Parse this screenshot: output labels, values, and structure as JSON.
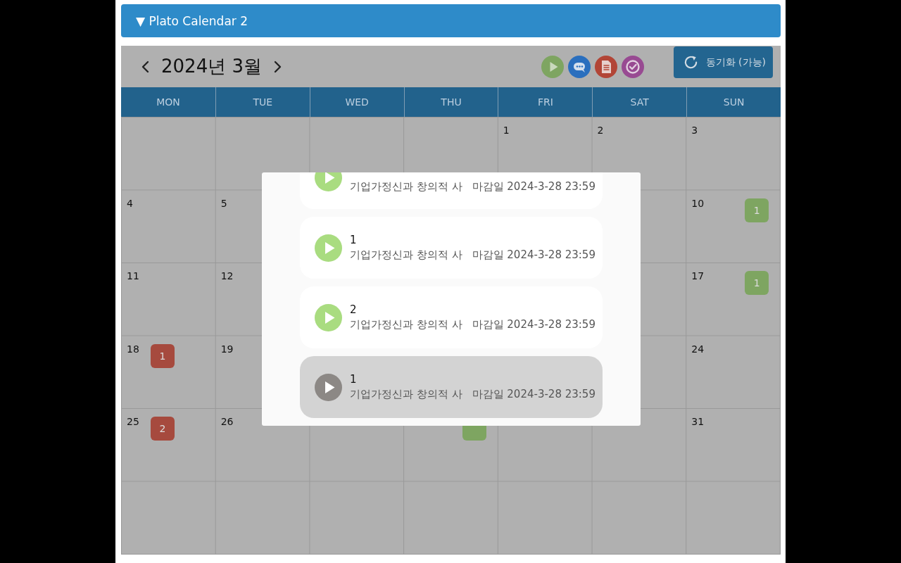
{
  "panel": {
    "title": "▼ Plato Calendar 2"
  },
  "calendar": {
    "month_label": "2024년 3월",
    "sync_button": "동기화 (가능)",
    "weekdays": [
      "MON",
      "TUE",
      "WED",
      "THU",
      "FRI",
      "SAT",
      "SUN"
    ],
    "weeks": [
      {
        "fri": {
          "day": "1"
        },
        "sat": {
          "day": "2"
        },
        "sun": {
          "day": "3"
        }
      },
      {
        "mon": {
          "day": "4"
        },
        "tue": {
          "day": "5"
        },
        "sun": {
          "day": "10",
          "badges": [
            {
              "kind": "video",
              "text": "1",
              "color": "#7ea561"
            }
          ]
        }
      },
      {
        "mon": {
          "day": "11"
        },
        "tue": {
          "day": "12"
        },
        "sun": {
          "day": "17",
          "badges": [
            {
              "kind": "video",
              "text": "1",
              "color": "#7ea561"
            }
          ]
        }
      },
      {
        "mon": {
          "day": "18",
          "badges": [
            {
              "kind": "assignment",
              "text": "1",
              "color": "#a64a3e"
            }
          ]
        },
        "tue": {
          "day": "19"
        },
        "sun": {
          "day": "24"
        }
      },
      {
        "mon": {
          "day": "25",
          "badges": [
            {
              "kind": "assignment",
              "text": "2",
              "color": "#a64a3e"
            }
          ]
        },
        "tue": {
          "day": "26"
        },
        "thu": {
          "badges": [
            {
              "kind": "video",
              "color": "#7ea561"
            }
          ]
        },
        "sun": {
          "day": "31"
        }
      }
    ]
  },
  "popup": {
    "items": [
      {
        "description": "기업가정신과 창의적 사",
        "deadline": "마감일 2024-3-28 23:59",
        "disabled": false
      },
      {
        "title": "1",
        "description": "기업가정신과 창의적 사",
        "deadline": "마감일 2024-3-28 23:59",
        "disabled": false
      },
      {
        "title": "2",
        "description": "기업가정신과 창의적 사",
        "deadline": "마감일 2024-3-28 23:59",
        "disabled": false
      },
      {
        "title": "1",
        "description": "기업가정신과 창의적 사",
        "deadline": "마감일 2024-3-28 23:59",
        "disabled": true
      }
    ]
  }
}
